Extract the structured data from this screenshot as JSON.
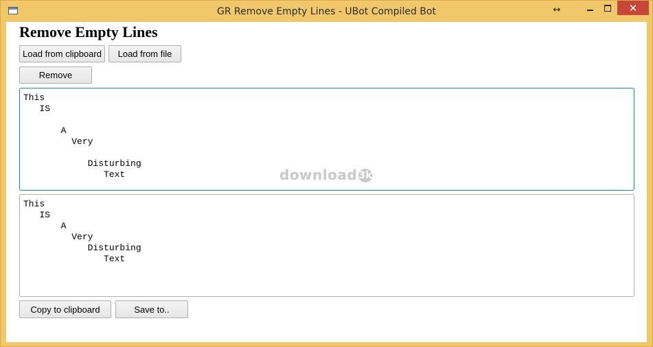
{
  "window": {
    "title": "GR Remove Empty Lines - UBot Compiled Bot",
    "close_glyph": "✕",
    "resize_glyph": "↔"
  },
  "main": {
    "heading": "Remove Empty Lines",
    "buttons": {
      "load_clipboard": "Load from clipboard",
      "load_file": "Load from file",
      "remove": "Remove",
      "copy_clipboard": "Copy to clipboard",
      "save_to": "Save to.."
    },
    "input_text": "This\n   IS\n\n       A\n         Very\n\n            Disturbing\n               Text",
    "output_text": "This\n   IS\n       A\n         Very\n            Disturbing\n               Text"
  },
  "watermark": {
    "text": "download",
    "badge": "3k"
  },
  "colors": {
    "frame": "#f0c869",
    "close_button": "#c7463a",
    "focus_border": "#1b8a8e"
  },
  "icons": [
    "app-window-icon",
    "resize-arrows-icon",
    "minimize-icon",
    "maximize-icon",
    "close-icon"
  ]
}
